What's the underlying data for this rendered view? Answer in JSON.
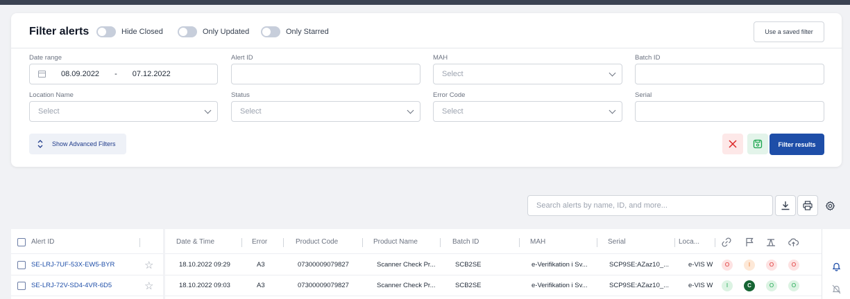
{
  "filter": {
    "title": "Filter alerts",
    "toggles": [
      "Hide Closed",
      "Only Updated",
      "Only Starred"
    ],
    "saved_filter_label": "Use a saved filter",
    "fields": {
      "date_range": {
        "label": "Date range",
        "from": "08.09.2022",
        "separator": "-",
        "to": "07.12.2022"
      },
      "alert_id": {
        "label": "Alert ID",
        "value": ""
      },
      "mah": {
        "label": "MAH",
        "value": "Select"
      },
      "batch_id": {
        "label": "Batch ID",
        "value": ""
      },
      "location_name": {
        "label": "Location Name",
        "value": "Select"
      },
      "status": {
        "label": "Status",
        "value": "Select"
      },
      "error_code": {
        "label": "Error Code",
        "value": "Select"
      },
      "serial": {
        "label": "Serial",
        "value": ""
      }
    },
    "advanced_label": "Show Advanced Filters",
    "filter_results_label": "Filter results"
  },
  "search": {
    "placeholder": "Search alerts by name, ID, and more..."
  },
  "table": {
    "columns": {
      "alert_id": "Alert ID",
      "datetime": "Date & Time",
      "error": "Error",
      "product_code": "Product Code",
      "product_name": "Product Name",
      "batch_id": "Batch ID",
      "mah": "MAH",
      "serial": "Serial",
      "location": "Loca..."
    },
    "rows": [
      {
        "alert_id": "SE-LRJ-7UF-53X-EW5-BYR",
        "datetime": "18.10.2022 09:29",
        "error": "A3",
        "product_code": "07300009079827",
        "product_name": "Scanner Check Pr...",
        "batch_id": "SCB2SE",
        "mah": "e-Verifikation i Sv...",
        "serial": "SCP9SE:AZaz10_...",
        "location": "e-VIS W",
        "badges": [
          {
            "text": "O",
            "color": "#dc2626"
          },
          {
            "text": "I",
            "color": "#ea7a2e"
          },
          {
            "text": "O",
            "color": "#dc2626"
          },
          {
            "text": "O",
            "color": "#dc2626"
          }
        ]
      },
      {
        "alert_id": "SE-LRJ-72V-SD4-4VR-6D5",
        "datetime": "18.10.2022 09:03",
        "error": "A3",
        "product_code": "07300009079827",
        "product_name": "Scanner Check Pr...",
        "batch_id": "SCB2SE",
        "mah": "e-Verifikation i Sv...",
        "serial": "SCP9SE:AZaz10_...",
        "location": "e-VIS W",
        "badges": [
          {
            "text": "I",
            "color": "#16a34a"
          },
          {
            "text": "C",
            "color": "#166534"
          },
          {
            "text": "O",
            "color": "#16a34a"
          },
          {
            "text": "O",
            "color": "#16a34a"
          }
        ]
      }
    ]
  },
  "colors": {
    "primary": "#1e4ea8",
    "danger": "#dc2626",
    "success": "#16a34a"
  }
}
